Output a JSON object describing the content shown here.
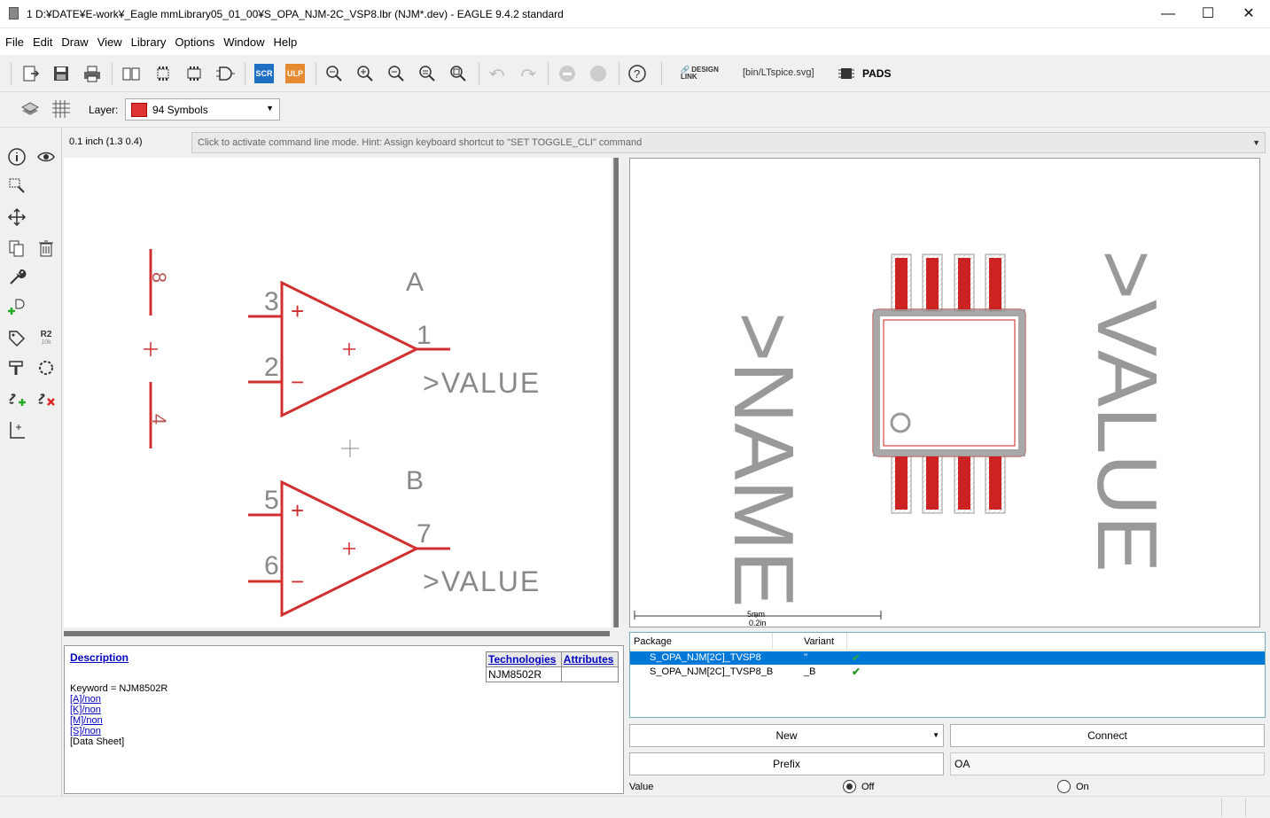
{
  "window": {
    "title": "1 D:¥DATE¥E-work¥_Eagle mmLibrary05_01_00¥S_OPA_NJM-2C_VSP8.lbr (NJM*.dev) - EAGLE 9.4.2 standard",
    "minimize": "—",
    "maximize": "☐",
    "close": "✕"
  },
  "menu": [
    "File",
    "Edit",
    "Draw",
    "View",
    "Library",
    "Options",
    "Window",
    "Help"
  ],
  "toolbar": {
    "scr": "SCR",
    "ulp": "ULP",
    "design_link": "DESIGN LINK",
    "ltspice": "[bin/LTspice.svg]",
    "pads": "PADS",
    "help": "?"
  },
  "layer": {
    "label": "Layer:",
    "value": "94 Symbols",
    "color": "#d22b2b"
  },
  "left_tools": {
    "r2": "R2",
    "r2_sub": "10k"
  },
  "coord": "0.1 inch (1.3 0.4)",
  "cmdline": {
    "placeholder": "Click to activate command line mode. Hint: Assign keyboard shortcut to \"SET TOGGLE_CLI\" command"
  },
  "schematic": {
    "gate_a": {
      "name": "A",
      "pin_pos": "3",
      "pin_neg": "2",
      "pin_out": "1",
      "value": ">VALUE",
      "plus": "+",
      "minus": "−"
    },
    "gate_b": {
      "name": "B",
      "pin_pos": "5",
      "pin_neg": "6",
      "pin_out": "7",
      "value": ">VALUE",
      "plus": "+",
      "minus": "−"
    },
    "power": {
      "pin_top": "8",
      "pin_bottom": "4"
    }
  },
  "package_view": {
    "name_text": ">NAME",
    "value_text": ">VALUE",
    "scale_top": "5mm",
    "scale_bottom": "0.2in"
  },
  "description": {
    "title": "Description",
    "keyword": "Keyword = NJM8502R",
    "links": [
      "[A]/non",
      "[K]/non",
      "[M]/non",
      "[S]/non"
    ],
    "datasheet": "[Data Sheet]",
    "tech_header": "Technologies",
    "attr_header": "Attributes",
    "tech_value": "NJM8502R"
  },
  "packages": {
    "col_package": "Package",
    "col_variant": "Variant",
    "rows": [
      {
        "package": "S_OPA_NJM[2C]_TVSP8",
        "variant": "''",
        "selected": true
      },
      {
        "package": "S_OPA_NJM[2C]_TVSP8_B",
        "variant": "_B",
        "selected": false
      }
    ],
    "check": "✔"
  },
  "buttons": {
    "new": "New",
    "connect": "Connect",
    "prefix": "Prefix",
    "prefix_value": "OA"
  },
  "value_row": {
    "label": "Value",
    "off": "Off",
    "on": "On",
    "selected": "off"
  },
  "colors": {
    "symbol": "#d03030",
    "pad": "#cc2222",
    "silk": "#999999",
    "select": "#0078d7"
  }
}
